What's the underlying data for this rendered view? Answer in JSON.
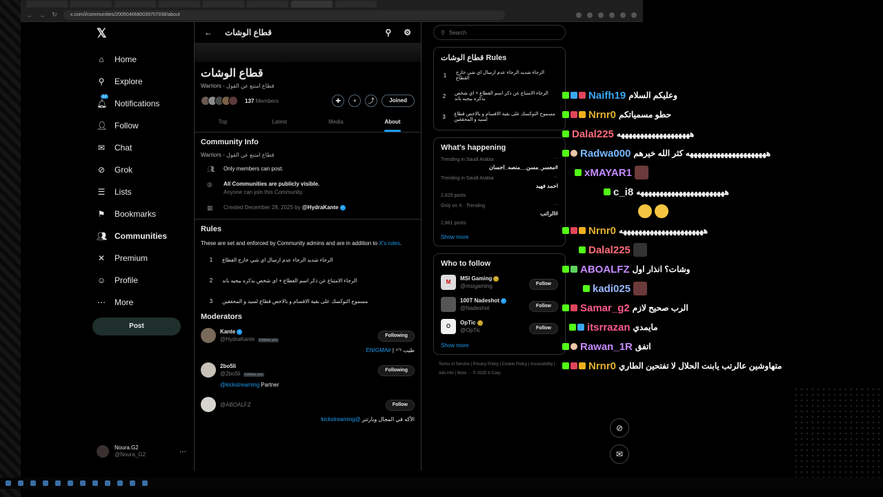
{
  "browser": {
    "tabs": [
      "",
      "",
      "",
      "",
      "",
      "",
      "",
      ""
    ],
    "url": "x.com/i/communities/2005046680039707038/about"
  },
  "nav": {
    "items": [
      {
        "label": "Home",
        "icon": "home-icon"
      },
      {
        "label": "Explore",
        "icon": "search-icon"
      },
      {
        "label": "Notifications",
        "icon": "bell-icon",
        "badge": "12"
      },
      {
        "label": "Follow",
        "icon": "add-user-icon"
      },
      {
        "label": "Chat",
        "icon": "chat-icon"
      },
      {
        "label": "Grok",
        "icon": "grok-icon"
      },
      {
        "label": "Lists",
        "icon": "list-icon"
      },
      {
        "label": "Bookmarks",
        "icon": "bookmark-icon"
      },
      {
        "label": "Communities",
        "icon": "communities-icon"
      },
      {
        "label": "Premium",
        "icon": "x-icon"
      },
      {
        "label": "Profile",
        "icon": "profile-icon"
      },
      {
        "label": "More",
        "icon": "more-circle-icon"
      }
    ],
    "post_label": "Post",
    "account": {
      "name": "Noura.G2",
      "handle": "@Noura_G2"
    }
  },
  "community": {
    "header_title": "قطاع الوشات",
    "title": "قطاع الوشات",
    "subtitle": "Warriors - قطاع امتنع عن القول",
    "member_count": "137",
    "members_label": "Members",
    "joined_label": "Joined",
    "tabs": [
      "Top",
      "Latest",
      "Media",
      "About"
    ],
    "active_tab": "About"
  },
  "info": {
    "title": "Community Info",
    "desc": "Warriors - قطاع امتنع عن القول",
    "only_members": "Only members can post.",
    "visible_title": "All Communities are publicly visible.",
    "visible_sub": "Anyone can join this Community.",
    "created": "Created December 28, 2025 by",
    "creator": "@HydraKante"
  },
  "rules": {
    "title": "Rules",
    "intro": "These are set and enforced by Community admins and are in addition to",
    "intro_link": "X's rules",
    "intro_end": ".",
    "items": [
      "الرجاء شديد الرجاء عدم ارسال اي شي خارج القطاع",
      "الرجاء الامتناع عن ذكر اسم القطاع + اي شخص يذكره بيجيه باند",
      "مسموح التوكسك على بقية الاقسام و بالاخص قطاع لسيد و المحققين"
    ]
  },
  "moderators": {
    "title": "Moderators",
    "items": [
      {
        "name": "Kante",
        "handle": "@HydraKante",
        "follows_you": "Follows you",
        "button": "Following",
        "bio": "طيب ⁴⁷¹ | #ENIGMA",
        "bio_link": "#ENIGMA",
        "bio_text": "طيب ⁴⁷¹ | "
      },
      {
        "name": "2bo5li",
        "handle": "@2bo5li",
        "follows_you": "Follows you",
        "button": "Following",
        "bio_link": "@kickstreaming",
        "bio_text": " Partner"
      },
      {
        "name": "",
        "handle": "@ABOALFZ",
        "follows_you": "",
        "button": "Follow",
        "bio_link": "@kickstreaming",
        "bio_text": "الأكه في المجال وبارتنر "
      }
    ]
  },
  "right": {
    "search_placeholder": "Search",
    "rules_card_title": "قطاع الوشات Rules",
    "rules": [
      "الرجاء شديد الرجاء عدم ارسال اي شي خارج القطاع",
      "الرجاء الامتناع عن ذكر اسم القطاع + اي شخص يذكره بيجيه باند",
      "مسموح التوكسك على بقية الاقسام و بالاخص قطاع لسيد و المحققين"
    ],
    "happening_title": "What's happening",
    "trends": [
      {
        "context": "Trending in Saudi Arabia",
        "title": "#معسر_مسن__منصه_احسان",
        "count": ""
      },
      {
        "context": "Trending in Saudi Arabia",
        "title": "احمد فهيد",
        "count": "2,825 posts"
      },
      {
        "context": "Only on X · Trending",
        "title": "#الراتب",
        "count": "2,881 posts"
      }
    ],
    "show_more": "Show more",
    "who_title": "Who to follow",
    "who": [
      {
        "name": "MSI Gaming",
        "handle": "@msigaming",
        "button": "Follow"
      },
      {
        "name": "100T Nadeshot",
        "handle": "@Nadeshot",
        "button": "Follow"
      },
      {
        "name": "OpTic",
        "handle": "@OpTic",
        "button": "Follow"
      }
    ],
    "footer": "Terms of Service | Privacy Policy | Cookie Policy | Accessibility | Ads info | More ··· © 2025 X Corp."
  },
  "chat": [
    {
      "user": "Naifh19",
      "color": "#3aa6f0",
      "msg": "وعليكم السلام"
    },
    {
      "user": "Nrnr0",
      "color": "#e0b030",
      "msg": "حطو مسمياتكم"
    },
    {
      "user": "Dalal225",
      "color": "#ff6b7a",
      "msg": "هههههههههههههههههههه"
    },
    {
      "user": "Radwa000",
      "color": "#7ab8ff",
      "msg": "هههههههههههههههههههههه كثر الله خيرهم"
    },
    {
      "user": "xMAYAR1",
      "color": "#c58bff",
      "msg": ""
    },
    {
      "user": "c_i8",
      "color": "#e7e9ea",
      "msg": "هههههههههههههههههههههههه"
    },
    {
      "user": "Nrnr0",
      "color": "#e0b030",
      "msg": "ههههههههههههههههههههههه"
    },
    {
      "user": "Dalal225",
      "color": "#ff6b7a",
      "msg": ""
    },
    {
      "user": "ABOALFZ",
      "color": "#c58bff",
      "msg": "وشات؟ انذار اول"
    },
    {
      "user": "kadi025",
      "color": "#9ab8ff",
      "msg": ""
    },
    {
      "user": "Samar_g2",
      "color": "#ff5a8a",
      "msg": "الرب صحيح لازم"
    },
    {
      "user": "itsrrazan",
      "color": "#ff5a8a",
      "msg": "مايمدي"
    },
    {
      "user": "Rawan_1R",
      "color": "#c58bff",
      "msg": "اتفق"
    },
    {
      "user": "Nrnr0",
      "color": "#e0b030",
      "msg": "متهاوشين عالرتب يابنت الحلال لا تفتحين الطاري"
    }
  ]
}
